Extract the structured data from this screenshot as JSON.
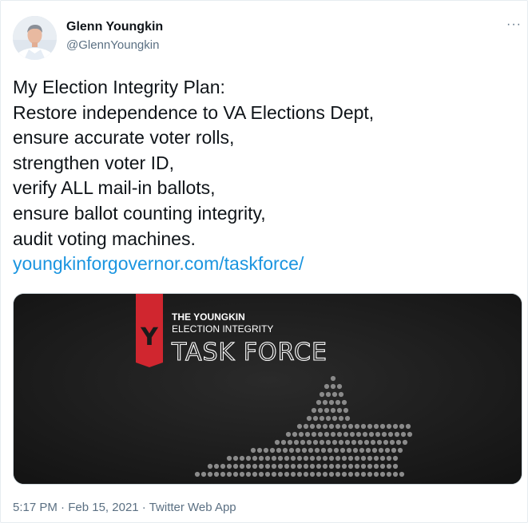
{
  "author": {
    "display_name": "Glenn Youngkin",
    "handle": "@GlennYoungkin"
  },
  "more_menu": "···",
  "tweet": {
    "lines": [
      "My Election Integrity Plan:",
      "Restore independence to VA Elections Dept,",
      "ensure accurate voter rolls,",
      "strengthen voter ID,",
      "verify ALL mail-in ballots,",
      "ensure ballot counting integrity,",
      "audit voting machines."
    ],
    "link": "youngkinforgovernor.com/taskforce/"
  },
  "media": {
    "badge_letter": "Y",
    "line1": "THE YOUNGKIN",
    "line2": "ELECTION INTEGRITY",
    "line3": "TASK FORCE",
    "colors": {
      "background": "#1c1c1c",
      "badge": "#d0262f",
      "text": "#ffffff",
      "dots": "#8a8a8a"
    }
  },
  "meta": {
    "time": "5:17 PM",
    "separator": " · ",
    "date": "Feb 15, 2021",
    "source": "Twitter Web App"
  },
  "colors": {
    "link": "#1b95e0",
    "secondary_text": "#5b7083",
    "primary_text": "#0f1419"
  }
}
